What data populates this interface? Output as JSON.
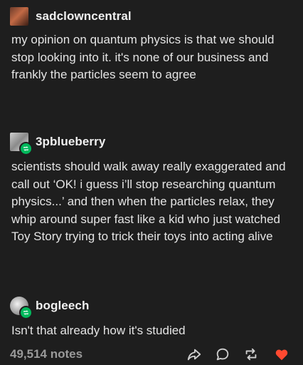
{
  "posts": [
    {
      "username": "sadclowncentral",
      "text": "my opinion on quantum physics is that we should stop looking into it. it's none of our business and frankly the particles seem to agree",
      "avatar": "avatar-icon",
      "reblogged": false
    },
    {
      "username": "3pblueberry",
      "text": "scientists should walk away really exaggerated and call out ‘OK! i guess i’ll stop researching quantum physics...’ and then when the particles relax, they whip around super fast like a kid who just watched Toy Story trying to trick their toys into acting alive",
      "avatar": "avatar-icon",
      "reblogged": true
    },
    {
      "username": "bogleech",
      "text": "Isn't that already how it's studied",
      "avatar": "avatar-icon",
      "reblogged": true
    }
  ],
  "footer": {
    "notes": "49,514 notes",
    "icons": [
      "share-icon",
      "reply-icon",
      "reblog-icon",
      "like-icon"
    ],
    "colors": {
      "reblog": "#00b85c",
      "like": "#ff4930",
      "icons": "#cfcfcf"
    }
  }
}
